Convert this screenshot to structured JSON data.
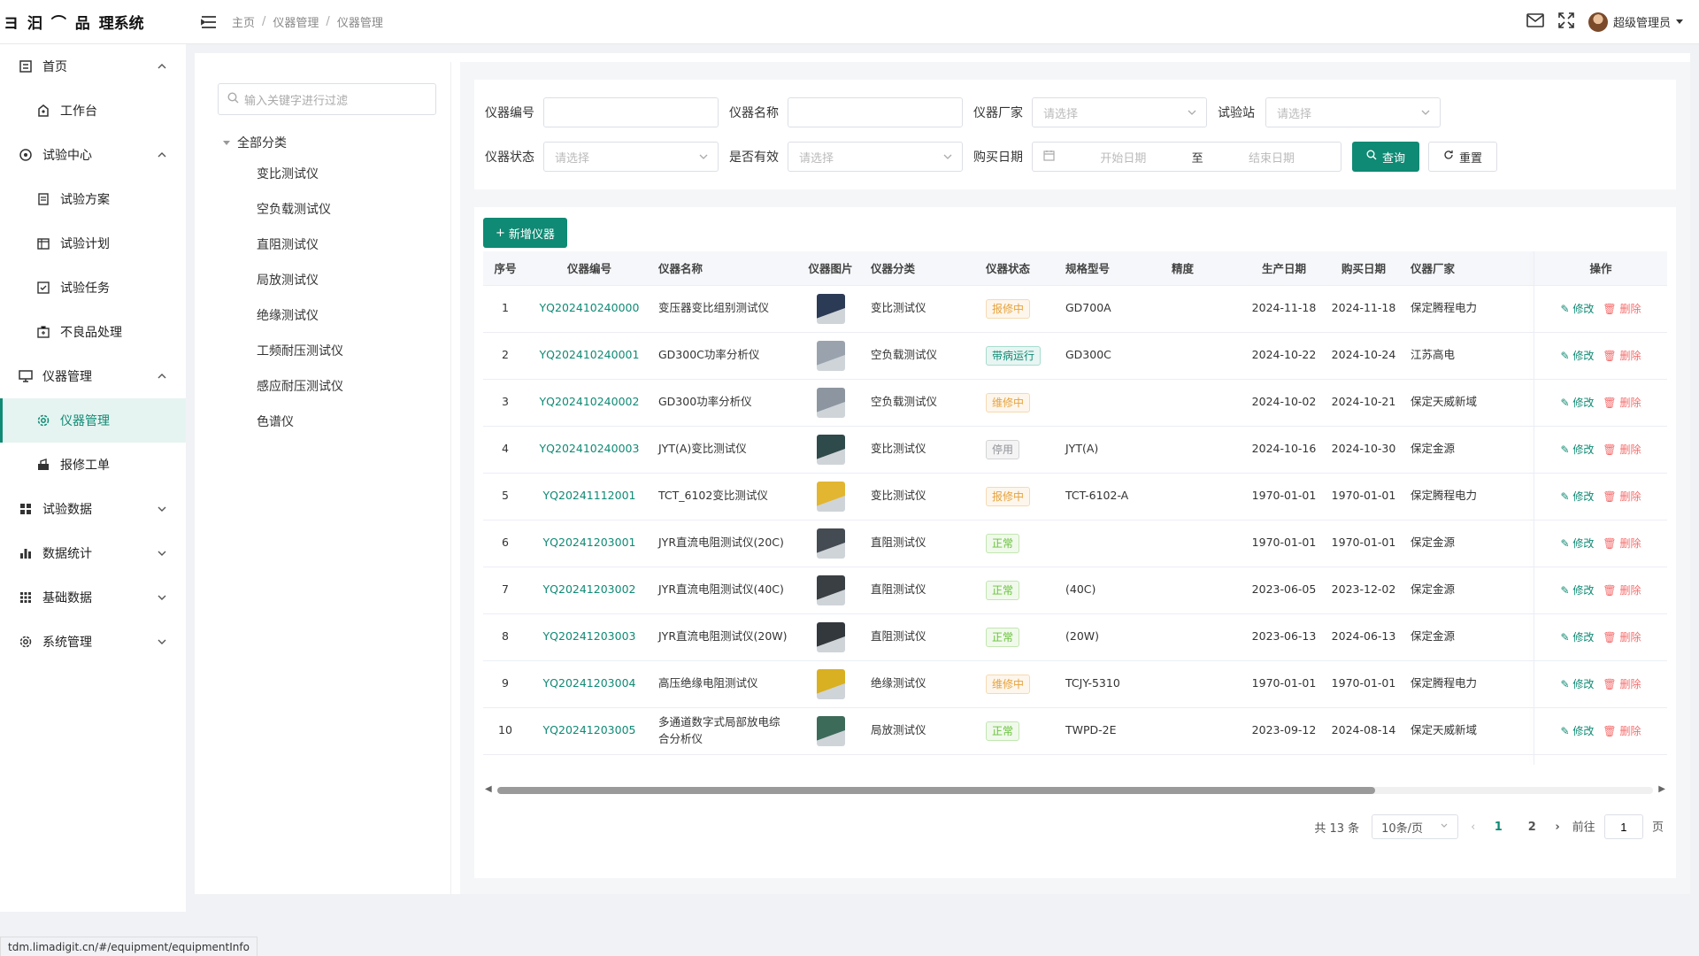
{
  "app": {
    "title": "理系统"
  },
  "breadcrumb": [
    "主页",
    "仪器管理",
    "仪器管理"
  ],
  "user": {
    "name": "超级管理员"
  },
  "sidebar": {
    "items": [
      {
        "label": "首页",
        "type": "group"
      },
      {
        "label": "工作台",
        "type": "sub"
      },
      {
        "label": "试验中心",
        "type": "group"
      },
      {
        "label": "试验方案",
        "type": "sub"
      },
      {
        "label": "试验计划",
        "type": "sub"
      },
      {
        "label": "试验任务",
        "type": "sub"
      },
      {
        "label": "不良品处理",
        "type": "sub"
      },
      {
        "label": "仪器管理",
        "type": "group"
      },
      {
        "label": "仪器管理",
        "type": "sub",
        "active": true
      },
      {
        "label": "报修工单",
        "type": "sub"
      },
      {
        "label": "试验数据",
        "type": "group"
      },
      {
        "label": "数据统计",
        "type": "group"
      },
      {
        "label": "基础数据",
        "type": "group"
      },
      {
        "label": "系统管理",
        "type": "group"
      }
    ]
  },
  "tree": {
    "search_placeholder": "输入关键字进行过滤",
    "root": "全部分类",
    "nodes": [
      "变比测试仪",
      "空负载测试仪",
      "直阻测试仪",
      "局放测试仪",
      "绝缘测试仪",
      "工频耐压测试仪",
      "感应耐压测试仪",
      "色谱仪"
    ]
  },
  "filters": {
    "code_label": "仪器编号",
    "name_label": "仪器名称",
    "vendor_label": "仪器厂家",
    "station_label": "试验站",
    "status_label": "仪器状态",
    "valid_label": "是否有效",
    "date_label": "购买日期",
    "select_placeholder": "请选择",
    "start_date": "开始日期",
    "to": "至",
    "end_date": "结束日期",
    "search_btn": "查询",
    "reset_btn": "重置"
  },
  "table": {
    "add_btn": "新增仪器",
    "headers": [
      "序号",
      "仪器编号",
      "仪器名称",
      "仪器图片",
      "仪器分类",
      "仪器状态",
      "规格型号",
      "精度",
      "生产日期",
      "购买日期",
      "仪器厂家",
      "操作"
    ],
    "edit_label": "修改",
    "delete_label": "删除",
    "rows": [
      {
        "no": "1",
        "code": "YQ202410240000",
        "name": "变压器变比组别测试仪",
        "category": "变比测试仪",
        "status": "报修中",
        "status_color": "orange",
        "model": "GD700A",
        "precision": "",
        "prod_date": "2024-11-18",
        "buy_date": "2024-11-18",
        "vendor": "保定腾程电力",
        "img_color": "#2b3a55"
      },
      {
        "no": "2",
        "code": "YQ202410240001",
        "name": "GD300C功率分析仪",
        "category": "空负载测试仪",
        "status": "带病运行",
        "status_color": "teal",
        "model": "GD300C",
        "precision": "",
        "prod_date": "2024-10-22",
        "buy_date": "2024-10-24",
        "vendor": "江苏高电",
        "img_color": "#9aa3ad"
      },
      {
        "no": "3",
        "code": "YQ202410240002",
        "name": "GD300功率分析仪",
        "category": "空负载测试仪",
        "status": "维修中",
        "status_color": "orange",
        "model": "",
        "precision": "",
        "prod_date": "2024-10-02",
        "buy_date": "2024-10-21",
        "vendor": "保定天威新域",
        "img_color": "#8d96a0"
      },
      {
        "no": "4",
        "code": "YQ202410240003",
        "name": "JYT(A)变比测试仪",
        "category": "变比测试仪",
        "status": "停用",
        "status_color": "gray",
        "model": "JYT(A)",
        "precision": "",
        "prod_date": "2024-10-16",
        "buy_date": "2024-10-30",
        "vendor": "保定金源",
        "img_color": "#2f4a4a"
      },
      {
        "no": "5",
        "code": "YQ20241112001",
        "name": "TCT_6102变比测试仪",
        "category": "变比测试仪",
        "status": "报修中",
        "status_color": "orange",
        "model": "TCT-6102-A",
        "precision": "",
        "prod_date": "1970-01-01",
        "buy_date": "1970-01-01",
        "vendor": "保定腾程电力",
        "img_color": "#e2b630"
      },
      {
        "no": "6",
        "code": "YQ20241203001",
        "name": "JYR直流电阻测试仪(20C)",
        "category": "直阻测试仪",
        "status": "正常",
        "status_color": "green",
        "model": "",
        "precision": "",
        "prod_date": "1970-01-01",
        "buy_date": "1970-01-01",
        "vendor": "保定金源",
        "img_color": "#444b52"
      },
      {
        "no": "7",
        "code": "YQ20241203002",
        "name": "JYR直流电阻测试仪(40C)",
        "category": "直阻测试仪",
        "status": "正常",
        "status_color": "green",
        "model": "(40C)",
        "precision": "",
        "prod_date": "2023-06-05",
        "buy_date": "2023-12-02",
        "vendor": "保定金源",
        "img_color": "#3a3f44"
      },
      {
        "no": "8",
        "code": "YQ20241203003",
        "name": "JYR直流电阻测试仪(20W)",
        "category": "直阻测试仪",
        "status": "正常",
        "status_color": "green",
        "model": "(20W)",
        "precision": "",
        "prod_date": "2023-06-13",
        "buy_date": "2024-06-13",
        "vendor": "保定金源",
        "img_color": "#33383d"
      },
      {
        "no": "9",
        "code": "YQ20241203004",
        "name": "高压绝缘电阻测试仪",
        "category": "绝缘测试仪",
        "status": "维修中",
        "status_color": "orange",
        "model": "TCJY-5310",
        "precision": "",
        "prod_date": "1970-01-01",
        "buy_date": "1970-01-01",
        "vendor": "保定腾程电力",
        "img_color": "#d9b021"
      },
      {
        "no": "10",
        "code": "YQ20241203005",
        "name": "多通道数字式局部放电综合分析仪",
        "category": "局放测试仪",
        "status": "正常",
        "status_color": "green",
        "model": "TWPD-2E",
        "precision": "",
        "prod_date": "2023-09-12",
        "buy_date": "2024-08-14",
        "vendor": "保定天威新域",
        "img_color": "#3d6b5a"
      }
    ]
  },
  "pagination": {
    "total": "共 13 条",
    "page_size": "10条/页",
    "pages": [
      "1",
      "2"
    ],
    "current": "1",
    "goto_label": "前往",
    "goto_value": "1",
    "page_suffix": "页"
  },
  "status_url": "tdm.limadigit.cn/#/equipment/equipmentInfo",
  "colors": {
    "primary": "#0f8a74",
    "danger": "#f56c6c",
    "warning": "#e6a23c",
    "success": "#67c23a"
  }
}
